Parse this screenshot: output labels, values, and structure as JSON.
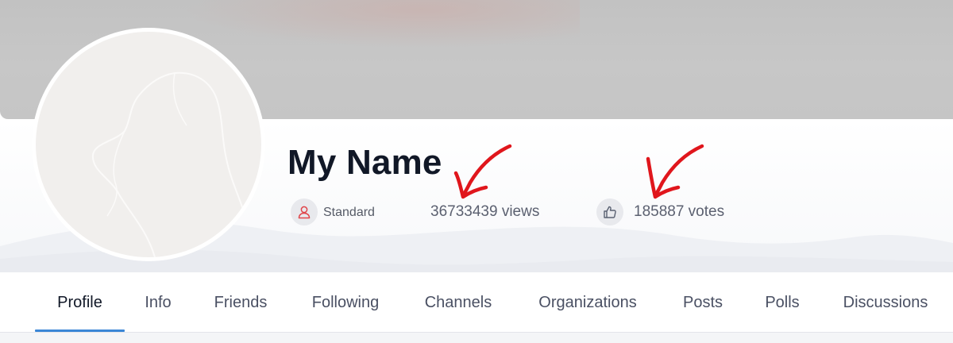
{
  "profile": {
    "name": "My Name",
    "account_type": "Standard",
    "views": "36733439 views",
    "votes": "185887 votes"
  },
  "icons": {
    "account_type": "user-icon",
    "votes": "thumbs-up-icon",
    "annotation": "red-arrow-icon"
  },
  "colors": {
    "accent": "#3b86d6",
    "user_icon": "#e0454a",
    "annotation_arrow": "#e0161c"
  },
  "tabs": [
    {
      "label": "Profile",
      "active": true
    },
    {
      "label": "Info",
      "active": false
    },
    {
      "label": "Friends",
      "active": false
    },
    {
      "label": "Following",
      "active": false
    },
    {
      "label": "Channels",
      "active": false
    },
    {
      "label": "Organizations",
      "active": false
    },
    {
      "label": "Posts",
      "active": false
    },
    {
      "label": "Polls",
      "active": false
    },
    {
      "label": "Discussions",
      "active": false
    }
  ]
}
